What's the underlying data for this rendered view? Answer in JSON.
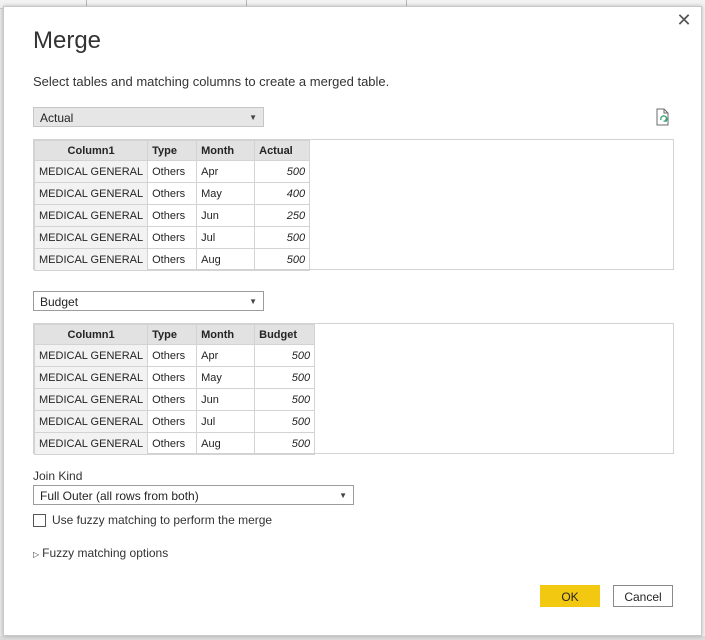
{
  "dialog": {
    "title": "Merge",
    "subtitle": "Select tables and matching columns to create a merged table.",
    "close_glyph": "✕"
  },
  "table1": {
    "selected": "Actual",
    "columns": [
      "Column1",
      "Type",
      "Month",
      "Actual"
    ],
    "rows": [
      [
        "MEDICAL GENERAL",
        "Others",
        "Apr",
        "500"
      ],
      [
        "MEDICAL GENERAL",
        "Others",
        "May",
        "400"
      ],
      [
        "MEDICAL GENERAL",
        "Others",
        "Jun",
        "250"
      ],
      [
        "MEDICAL GENERAL",
        "Others",
        "Jul",
        "500"
      ],
      [
        "MEDICAL GENERAL",
        "Others",
        "Aug",
        "500"
      ]
    ]
  },
  "table2": {
    "selected": "Budget",
    "columns": [
      "Column1",
      "Type",
      "Month",
      "Budget"
    ],
    "rows": [
      [
        "MEDICAL GENERAL",
        "Others",
        "Apr",
        "500"
      ],
      [
        "MEDICAL GENERAL",
        "Others",
        "May",
        "500"
      ],
      [
        "MEDICAL GENERAL",
        "Others",
        "Jun",
        "500"
      ],
      [
        "MEDICAL GENERAL",
        "Others",
        "Jul",
        "500"
      ],
      [
        "MEDICAL GENERAL",
        "Others",
        "Aug",
        "500"
      ]
    ]
  },
  "join": {
    "label": "Join Kind",
    "selected": "Full Outer (all rows from both)"
  },
  "fuzzy": {
    "checkbox_label": "Use fuzzy matching to perform the merge",
    "checked": false,
    "options_label": "Fuzzy matching options"
  },
  "buttons": {
    "ok": "OK",
    "cancel": "Cancel"
  },
  "colors": {
    "ok_button": "#f2c811",
    "header_bg": "#e2e2e2",
    "refresh_icon": "#2e9e6b"
  },
  "icons": {
    "close": "close-icon",
    "refresh_file": "refresh-file-icon",
    "caret": "chevron-down-icon",
    "expand": "triangle-right-icon"
  }
}
